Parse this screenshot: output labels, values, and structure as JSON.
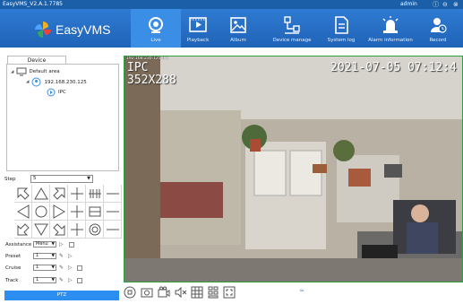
{
  "window": {
    "title": "EasyVMS_V2.A.1.7785",
    "user": "admin"
  },
  "app": {
    "name": "EasyVMS"
  },
  "nav": [
    {
      "label": "Live",
      "icon": "live-icon",
      "active": true
    },
    {
      "label": "Playback",
      "icon": "playback-icon",
      "active": false
    },
    {
      "label": "Album",
      "icon": "album-icon",
      "active": false
    },
    {
      "label": "Device manage",
      "icon": "device-manage-icon",
      "active": false
    },
    {
      "label": "System log",
      "icon": "system-log-icon",
      "active": false
    },
    {
      "label": "Alarm information",
      "icon": "alarm-icon",
      "active": false
    },
    {
      "label": "Record",
      "icon": "record-icon",
      "active": false
    }
  ],
  "sidebar": {
    "tab": "Device",
    "tree": {
      "area": "Default area",
      "device_ip": "192.168.230.125",
      "channel": "IPC"
    }
  },
  "ptz": {
    "step_label": "Step",
    "step_value": "5",
    "assistance_label": "Assistance",
    "assistance_value": "Menu",
    "preset_label": "Preset",
    "preset_value": "1",
    "cruise_label": "Cruise",
    "cruise_value": "1",
    "track_label": "Track",
    "track_value": "1",
    "button_label": "PTZ"
  },
  "video": {
    "tag": "192.168.230.125-IPC",
    "osd_name": "IPC",
    "osd_resolution": "352X288",
    "osd_time": "2021-07-05 07:12:4"
  },
  "colors": {
    "title_bar": "#1b5fa8",
    "nav_bar": "#2369bd",
    "nav_active": "#3b8ee6",
    "accent": "#2b8ef0",
    "video_border": "#2ea043"
  }
}
